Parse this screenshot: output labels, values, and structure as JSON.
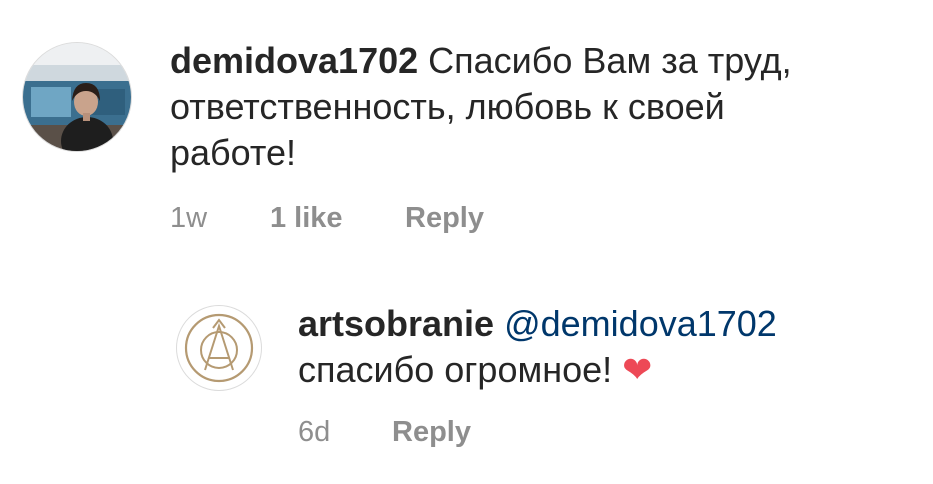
{
  "comments": [
    {
      "username": "demidova1702",
      "text": "Спасибо Вам за труд, ответственность, любовь к своей работе!",
      "time": "1w",
      "likes": "1 like",
      "reply_label": "Reply",
      "avatar": "user-photo-avatar"
    },
    {
      "username": "artsobranie",
      "mention": "@demidova1702",
      "text": "спасибо огромное!",
      "emoji": "❤",
      "time": "6d",
      "reply_label": "Reply",
      "avatar": "artsobranie-logo-avatar"
    }
  ],
  "colors": {
    "text": "#262626",
    "meta": "#8e8e8e",
    "mention": "#00376b",
    "heart": "#ed4956"
  }
}
